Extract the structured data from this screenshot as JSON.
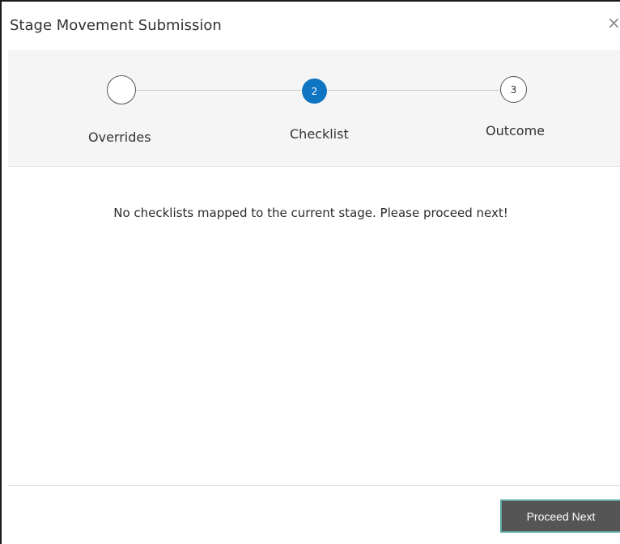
{
  "dialog": {
    "title": "Stage Movement Submission",
    "close_glyph": "×",
    "close_icon": "close-icon"
  },
  "steps": [
    {
      "number": "",
      "label": "Overrides",
      "state": "completed"
    },
    {
      "number": "2",
      "label": "Checklist",
      "state": "active"
    },
    {
      "number": "3",
      "label": "Outcome",
      "state": "pending"
    }
  ],
  "content": {
    "message": "No checklists mapped to the current stage. Please proceed next!"
  },
  "footer": {
    "proceed_label": "Proceed Next"
  },
  "colors": {
    "active_step": "#0f74c2",
    "button_bg": "#555555",
    "button_border": "#5aa5a0",
    "stepper_bg": "#f5f5f5"
  }
}
